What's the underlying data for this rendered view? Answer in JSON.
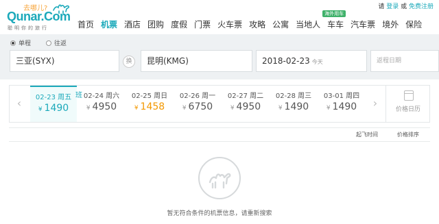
{
  "header": {
    "logo_slogan": "去哪儿?",
    "logo_brand": "Qunar.Com",
    "logo_tagline": "聪明你的旅行",
    "toplinks": {
      "prefix": "请",
      "login": "登录",
      "or": "或",
      "register": "免费注册",
      "extra": "|"
    },
    "nav": [
      {
        "label": "首页",
        "active": false
      },
      {
        "label": "机票",
        "active": true
      },
      {
        "label": "酒店",
        "active": false
      },
      {
        "label": "团购",
        "active": false
      },
      {
        "label": "度假",
        "active": false
      },
      {
        "label": "门票",
        "active": false
      },
      {
        "label": "火车票",
        "active": false
      },
      {
        "label": "攻略",
        "active": false
      },
      {
        "label": "公寓",
        "active": false
      },
      {
        "label": "当地人",
        "active": false
      },
      {
        "label": "车车",
        "active": false,
        "badge": "海外用车"
      },
      {
        "label": "汽车票",
        "active": false
      },
      {
        "label": "境外",
        "active": false
      },
      {
        "label": "保险",
        "active": false
      }
    ]
  },
  "search": {
    "trip_types": [
      {
        "label": "单程",
        "checked": true
      },
      {
        "label": "往返",
        "checked": false
      }
    ],
    "from": "三亚(SYX)",
    "swap_label": "换",
    "to": "昆明(KMG)",
    "date": "2018-02-23",
    "date_sub": "今天",
    "return_placeholder": "返程日期"
  },
  "date_strip": {
    "currency": "¥",
    "ban_tag": "班",
    "days": [
      {
        "date": "02-23 周五",
        "price": "1490",
        "selected": true,
        "low": false
      },
      {
        "date": "02-24 周六",
        "price": "4950",
        "selected": false,
        "low": false
      },
      {
        "date": "02-25 周日",
        "price": "1458",
        "selected": false,
        "low": true
      },
      {
        "date": "02-26 周一",
        "price": "6750",
        "selected": false,
        "low": false
      },
      {
        "date": "02-27 周二",
        "price": "4950",
        "selected": false,
        "low": false
      },
      {
        "date": "02-28 周三",
        "price": "1490",
        "selected": false,
        "low": false
      },
      {
        "date": "03-01 周四",
        "price": "1490",
        "selected": false,
        "low": false
      }
    ],
    "calendar_label": "价格日历"
  },
  "sort": {
    "departure": "起飞时间",
    "price": "价格排序"
  },
  "empty": {
    "message": "暂无符合条件的机票信息，请重新搜索"
  },
  "colors": {
    "brand": "#1ba9ba",
    "low_price": "#f39800",
    "badge": "#3fb16a"
  }
}
